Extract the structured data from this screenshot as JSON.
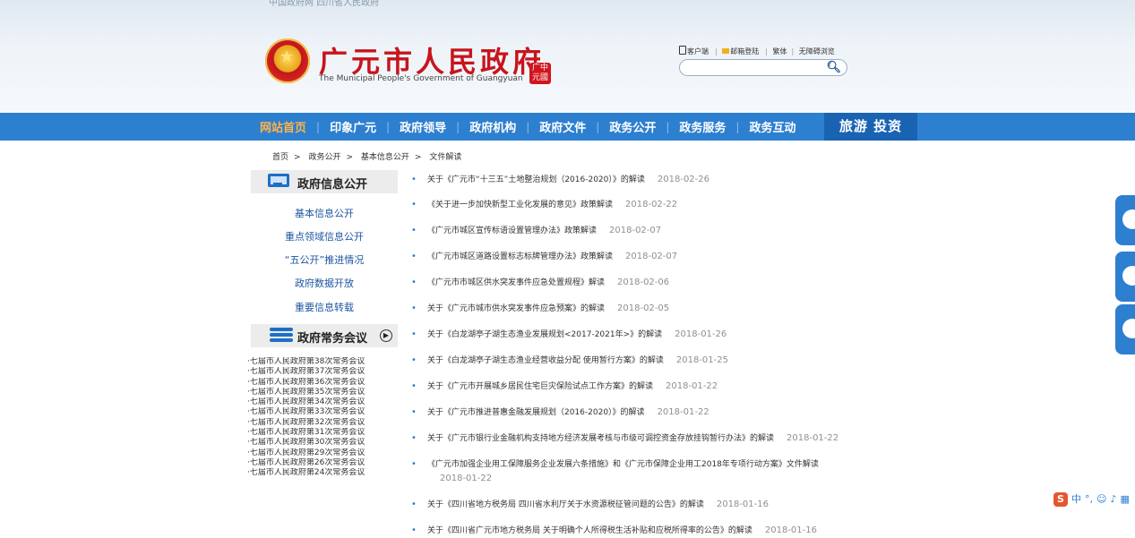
{
  "header": {
    "top_text": "中国政府网 四川省人民政府",
    "title": "广元市人民政府",
    "subtitle": "The Municipal People's Government of Guangyuan",
    "seal_text": "广元\n中国",
    "links": [
      "客户端",
      "邮箱登陆",
      "繁体",
      "无障碍浏览"
    ],
    "search_placeholder": ""
  },
  "nav": {
    "items": [
      "网站首页",
      "印象广元",
      "政府领导",
      "政府机构",
      "政府文件",
      "政务公开",
      "政务服务",
      "政务互动"
    ],
    "active_index": 0,
    "special": "旅游  投资"
  },
  "breadcrumb": [
    "首页",
    "政务公开",
    "基本信息公开",
    "文件解读"
  ],
  "sidebar": {
    "section1_title": "政府信息公开",
    "section1_links": [
      "基本信息公开",
      "重点领域信息公开",
      "“五公开”推进情况",
      "政府数据开放",
      "重要信息转载"
    ],
    "section2_title": "政府常务会议",
    "meetings": [
      "·七届市人民政府第38次常务会议",
      "·七届市人民政府第37次常务会议",
      "·七届市人民政府第36次常务会议",
      "·七届市人民政府第35次常务会议",
      "·七届市人民政府第34次常务会议",
      "·七届市人民政府第33次常务会议",
      "·七届市人民政府第32次常务会议",
      "·七届市人民政府第31次常务会议",
      "·七届市人民政府第30次常务会议",
      "·七届市人民政府第29次常务会议",
      "·七届市人民政府第26次常务会议",
      "·七届市人民政府第24次常务会议"
    ]
  },
  "documents": [
    {
      "title": "关于《广元市“十三五”土地整治规划（2016-2020）》的解读",
      "date": "2018-02-26"
    },
    {
      "title": "《关于进一步加快新型工业化发展的意见》政策解读",
      "date": "2018-02-22"
    },
    {
      "title": "《广元市城区宣传标语设置管理办法》政策解读",
      "date": "2018-02-07"
    },
    {
      "title": "《广元市城区道路设置标志标牌管理办法》政策解读",
      "date": "2018-02-07"
    },
    {
      "title": "《广元市市城区供水突发事件应急处置规程》解读",
      "date": "2018-02-06"
    },
    {
      "title": "关于《广元市城市供水突发事件应急预案》的解读",
      "date": "2018-02-05"
    },
    {
      "title": "关于《白龙湖亭子湖生态渔业发展规划<2017-2021年>》的解读",
      "date": "2018-01-26"
    },
    {
      "title": "关于《白龙湖亭子湖生态渔业经营收益分配 使用暂行方案》的解读",
      "date": "2018-01-25"
    },
    {
      "title": "关于《广元市开展城乡居民住宅巨灾保险试点工作方案》的解读",
      "date": "2018-01-22"
    },
    {
      "title": "关于《广元市推进普惠金融发展规划（2016-2020）》的解读",
      "date": "2018-01-22"
    },
    {
      "title": "关于《广元市银行业金融机构支持地方经济发展考核与市级可调控资金存放挂钩暂行办法》的解读",
      "date": "2018-01-22"
    },
    {
      "title": "《广元市加强企业用工保障服务企业发展六条措施》和《广元市保障企业用工2018年专项行动方案》文件解读",
      "date": "2018-01-22"
    },
    {
      "title": "关于《四川省地方税务局 四川省水利厅关于水资源税征管问题的公告》的解读",
      "date": "2018-01-16"
    },
    {
      "title": "关于《四川省广元市地方税务局 关于明确个人所得税生活补贴和应税所得率的公告》的解读",
      "date": "2018-01-16"
    }
  ],
  "colors": {
    "nav_bg": "#2d7fd0",
    "nav_active": "#ffb347",
    "title_red": "#c8141c",
    "link_blue": "#1e56a0"
  }
}
